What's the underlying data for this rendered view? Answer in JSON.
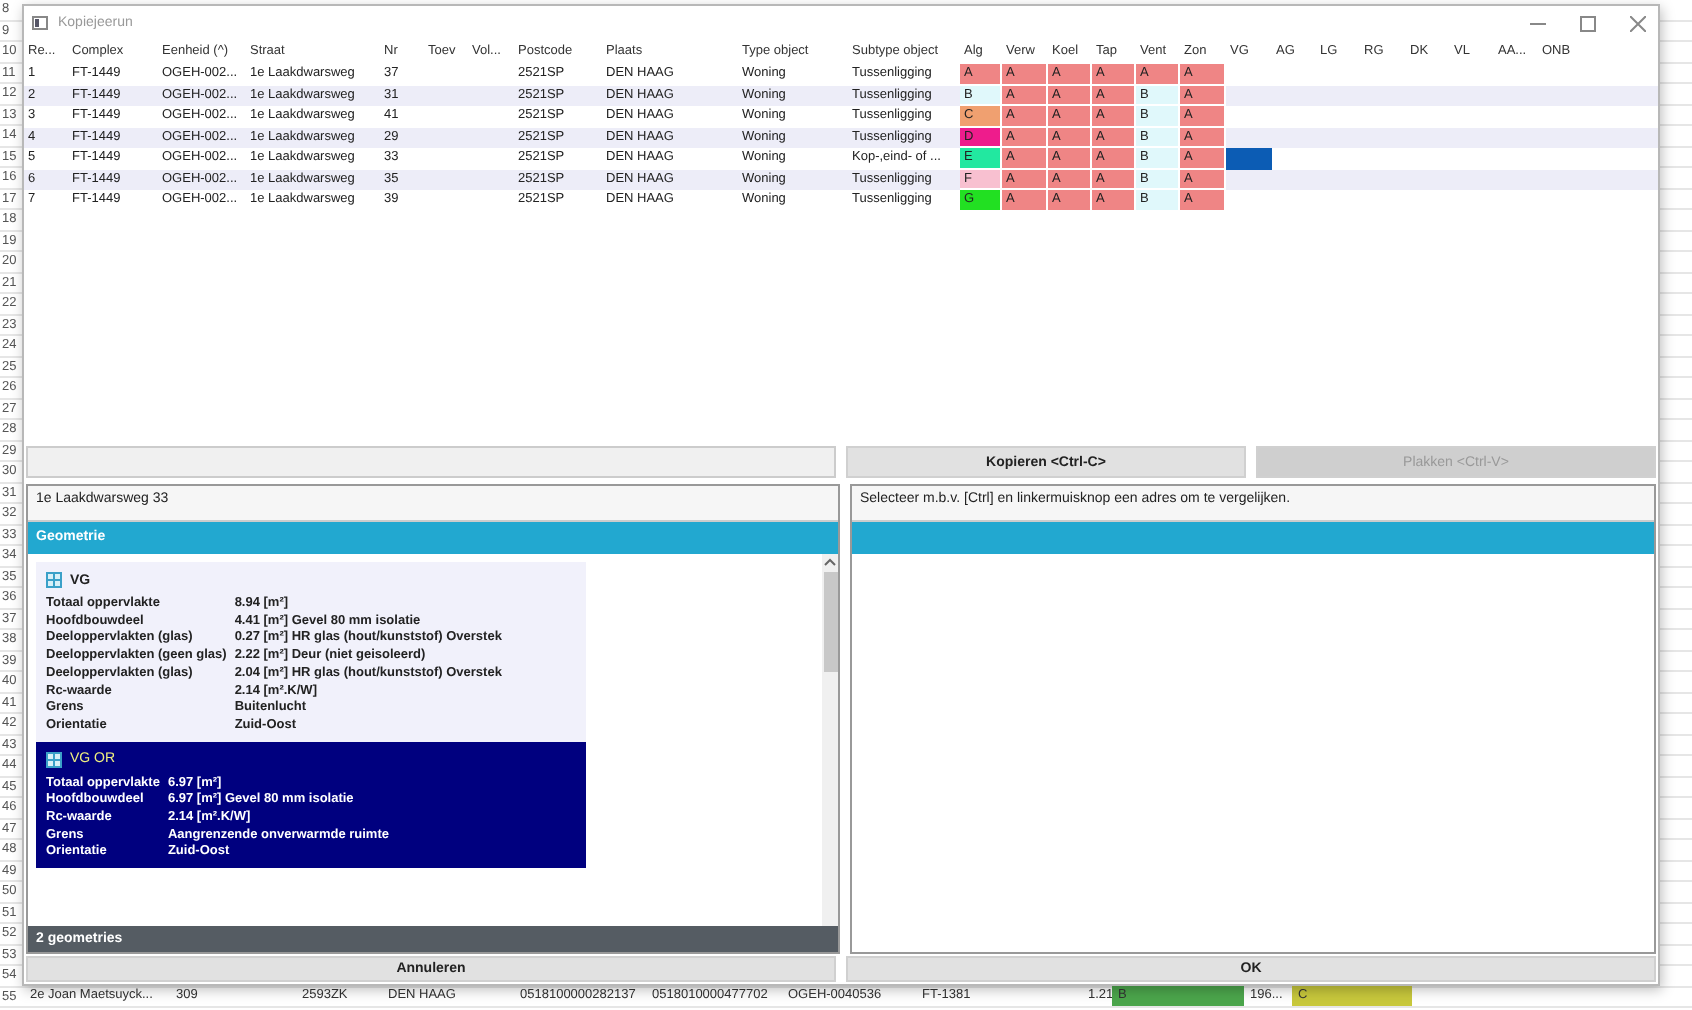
{
  "spreadsheet": {
    "row_numbers": [
      "8",
      "9",
      "10",
      "11",
      "12",
      "13",
      "14",
      "15",
      "16",
      "17",
      "18",
      "19",
      "20",
      "21",
      "22",
      "23",
      "24",
      "25",
      "26",
      "27",
      "28",
      "29",
      "30",
      "31",
      "32",
      "33",
      "34",
      "35",
      "36",
      "37",
      "38",
      "39",
      "40",
      "41",
      "42",
      "43",
      "44",
      "45",
      "46",
      "47",
      "48",
      "49",
      "50",
      "51",
      "52",
      "53",
      "54",
      "55"
    ],
    "last_row": [
      {
        "text": "2e Joan Maetsuyck..."
      },
      {
        "text": "309"
      },
      {
        "text": "2593ZK"
      },
      {
        "text": "DEN HAAG"
      },
      {
        "text": "0518100000282137"
      },
      {
        "text": "0518010000477702"
      },
      {
        "text": "OGEH-0040536"
      },
      {
        "text": "FT-1381"
      },
      {
        "text": "1.21"
      },
      {
        "text": "B",
        "color": "#4ca64c"
      },
      {
        "text": "196..."
      },
      {
        "text": "C",
        "color": "#c8c83c"
      }
    ]
  },
  "window": {
    "title": "Kopiejeerun"
  },
  "table": {
    "columns": [
      "Re...",
      "Complex",
      "Eenheid (^)",
      "Straat",
      "Nr",
      "Toev",
      "Vol...",
      "Postcode",
      "Plaats",
      "Type object",
      "Subtype object",
      "Alg",
      "Verw",
      "Koel",
      "Tap",
      "Vent",
      "Zon",
      "VG",
      "AG",
      "LG",
      "RG",
      "DK",
      "VL",
      "AA...",
      "ONB"
    ],
    "rows": [
      {
        "cells": [
          "1",
          "FT-1449",
          "OGEH-002...",
          "1e Laakdwarsweg",
          "37",
          null,
          null,
          "2521SP",
          "DEN HAAG",
          "Woning",
          "Tussenligging"
        ],
        "labels": [
          {
            "text": "A",
            "color": "#ef8585"
          },
          {
            "text": "A",
            "color": "#ef8585"
          },
          {
            "text": "A",
            "color": "#ef8585"
          },
          {
            "text": "A",
            "color": "#ef8585"
          },
          {
            "text": "A",
            "color": "#ef8585"
          },
          {
            "text": "A",
            "color": "#ef8585"
          }
        ],
        "vg_marked": false
      },
      {
        "cells": [
          "2",
          "FT-1449",
          "OGEH-002...",
          "1e Laakdwarsweg",
          "31",
          null,
          null,
          "2521SP",
          "DEN HAAG",
          "Woning",
          "Tussenligging"
        ],
        "labels": [
          {
            "text": "B",
            "color": "#e0f8fb"
          },
          {
            "text": "A",
            "color": "#ef8585"
          },
          {
            "text": "A",
            "color": "#ef8585"
          },
          {
            "text": "A",
            "color": "#ef8585"
          },
          {
            "text": "B",
            "color": "#e0f8fb"
          },
          {
            "text": "A",
            "color": "#ef8585"
          }
        ],
        "vg_marked": false
      },
      {
        "cells": [
          "3",
          "FT-1449",
          "OGEH-002...",
          "1e Laakdwarsweg",
          "41",
          null,
          null,
          "2521SP",
          "DEN HAAG",
          "Woning",
          "Tussenligging"
        ],
        "labels": [
          {
            "text": "C",
            "color": "#f0a070"
          },
          {
            "text": "A",
            "color": "#ef8585"
          },
          {
            "text": "A",
            "color": "#ef8585"
          },
          {
            "text": "A",
            "color": "#ef8585"
          },
          {
            "text": "B",
            "color": "#e0f8fb"
          },
          {
            "text": "A",
            "color": "#ef8585"
          }
        ],
        "vg_marked": false
      },
      {
        "cells": [
          "4",
          "FT-1449",
          "OGEH-002...",
          "1e Laakdwarsweg",
          "29",
          null,
          null,
          "2521SP",
          "DEN HAAG",
          "Woning",
          "Tussenligging"
        ],
        "labels": [
          {
            "text": "D",
            "color": "#ee1c8c"
          },
          {
            "text": "A",
            "color": "#ef8585"
          },
          {
            "text": "A",
            "color": "#ef8585"
          },
          {
            "text": "A",
            "color": "#ef8585"
          },
          {
            "text": "B",
            "color": "#e0f8fb"
          },
          {
            "text": "A",
            "color": "#ef8585"
          }
        ],
        "vg_marked": false
      },
      {
        "cells": [
          "5",
          "FT-1449",
          "OGEH-002...",
          "1e Laakdwarsweg",
          "33",
          null,
          null,
          "2521SP",
          "DEN HAAG",
          "Woning",
          "Kop-,eind- of ..."
        ],
        "labels": [
          {
            "text": "E",
            "color": "#22e8a0"
          },
          {
            "text": "A",
            "color": "#ef8585"
          },
          {
            "text": "A",
            "color": "#ef8585"
          },
          {
            "text": "A",
            "color": "#ef8585"
          },
          {
            "text": "B",
            "color": "#e0f8fb"
          },
          {
            "text": "A",
            "color": "#ef8585"
          }
        ],
        "vg_marked": true
      },
      {
        "cells": [
          "6",
          "FT-1449",
          "OGEH-002...",
          "1e Laakdwarsweg",
          "35",
          null,
          null,
          "2521SP",
          "DEN HAAG",
          "Woning",
          "Tussenligging"
        ],
        "labels": [
          {
            "text": "F",
            "color": "#f8c0d0"
          },
          {
            "text": "A",
            "color": "#ef8585"
          },
          {
            "text": "A",
            "color": "#ef8585"
          },
          {
            "text": "A",
            "color": "#ef8585"
          },
          {
            "text": "B",
            "color": "#e0f8fb"
          },
          {
            "text": "A",
            "color": "#ef8585"
          }
        ],
        "vg_marked": false
      },
      {
        "cells": [
          "7",
          "FT-1449",
          "OGEH-002...",
          "1e Laakdwarsweg",
          "39",
          null,
          null,
          "2521SP",
          "DEN HAAG",
          "Woning",
          "Tussenligging"
        ],
        "labels": [
          {
            "text": "G",
            "color": "#22e022"
          },
          {
            "text": "A",
            "color": "#ef8585"
          },
          {
            "text": "A",
            "color": "#ef8585"
          },
          {
            "text": "A",
            "color": "#ef8585"
          },
          {
            "text": "B",
            "color": "#e0f8fb"
          },
          {
            "text": "A",
            "color": "#ef8585"
          }
        ],
        "vg_marked": false
      }
    ]
  },
  "toolbar": {
    "copy_button": "Kopieren <Ctrl-C>",
    "paste_button": {
      "label": "Plakken <Ctrl-V>",
      "disabled": true
    }
  },
  "left_panel": {
    "address": "1e Laakdwarsweg 33",
    "section": "Geometrie",
    "geometries": [
      {
        "name": "VG",
        "selected": false,
        "properties": [
          [
            "Totaal oppervlakte",
            "8.94 [m²]"
          ],
          [
            "Hoofdbouwdeel",
            "4.41 [m²] Gevel 80 mm isolatie"
          ],
          [
            "Deeloppervlakten (glas)",
            "0.27 [m²] HR glas (hout/kunststof) Overstek"
          ],
          [
            "Deeloppervlakten (geen glas)",
            "2.22 [m²] Deur (niet geisoleerd)"
          ],
          [
            "Deeloppervlakten (glas)",
            "2.04 [m²] HR glas (hout/kunststof) Overstek"
          ],
          [
            "Rc-waarde",
            "2.14 [m².K/W]"
          ],
          [
            "Grens",
            "Buitenlucht"
          ],
          [
            "Orientatie",
            "Zuid-Oost"
          ]
        ]
      },
      {
        "name": "VG OR",
        "selected": true,
        "properties": [
          [
            "Totaal oppervlakte",
            "6.97 [m²]"
          ],
          [
            "Hoofdbouwdeel",
            "6.97 [m²] Gevel 80 mm isolatie"
          ],
          [
            "Rc-waarde",
            "2.14 [m².K/W]"
          ],
          [
            "Grens",
            "Aangrenzende onverwarmde ruimte"
          ],
          [
            "Orientatie",
            "Zuid-Oost"
          ]
        ]
      }
    ],
    "footer": "2 geometries"
  },
  "right_panel": {
    "message": "Selecteer m.b.v. [Ctrl] en linkermuisknop een adres om te vergelijken."
  },
  "buttons": {
    "cancel": "Annuleren",
    "ok": "OK"
  }
}
